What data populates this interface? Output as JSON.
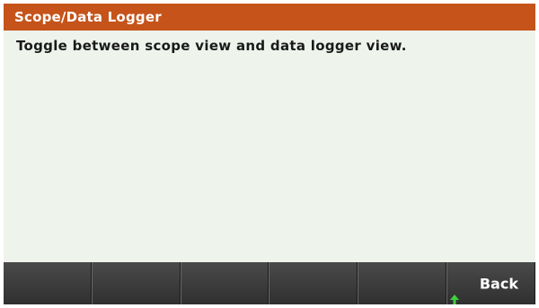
{
  "header": {
    "title": "Scope/Data Logger"
  },
  "body": {
    "text": "Toggle between scope view and data logger view."
  },
  "softkeys": [
    {
      "label": ""
    },
    {
      "label": ""
    },
    {
      "label": ""
    },
    {
      "label": ""
    },
    {
      "label": ""
    },
    {
      "label": "Back"
    }
  ],
  "colors": {
    "title_bar": "#c5531a",
    "screen_background": "#eef4ec",
    "softkey": "#3a3a3a",
    "arrow": "#3fd03f"
  },
  "icons": {
    "back_indicator": "up-arrow-icon"
  }
}
